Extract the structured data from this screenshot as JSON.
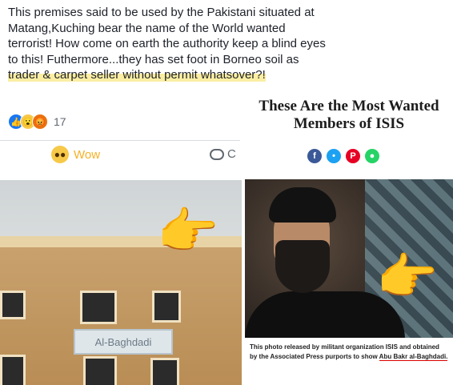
{
  "post": {
    "text_before": "This premises said to be used by the Pakistani situated at Matang,Kuching bear the name of the World wanted terrorist! How come on earth the authority keep a blind eyes to this! Futhermore...they has set foot in Borneo soil as ",
    "text_highlight": "trader & carpet seller without permit whatsover?!",
    "reaction_count": "17"
  },
  "actions": {
    "wow_label": "Wow",
    "comment_label": "C"
  },
  "left_photo": {
    "sign_text": "Al-Baghdadi"
  },
  "right_panel": {
    "title": "These Are the Most Wanted Members of ISIS",
    "caption_before": "This photo released by militant organization ISIS and obtained by the Associated Press purports to show ",
    "caption_underlined": "Abu Bakr al-Baghdadi."
  },
  "icons": {
    "share_colors": [
      "#3b5998",
      "#1da1f2",
      "#e60023",
      "#25d366"
    ]
  },
  "colors": {
    "highlight": "#fbeea3",
    "wow": "#f7b125",
    "like": "#1877f2"
  }
}
